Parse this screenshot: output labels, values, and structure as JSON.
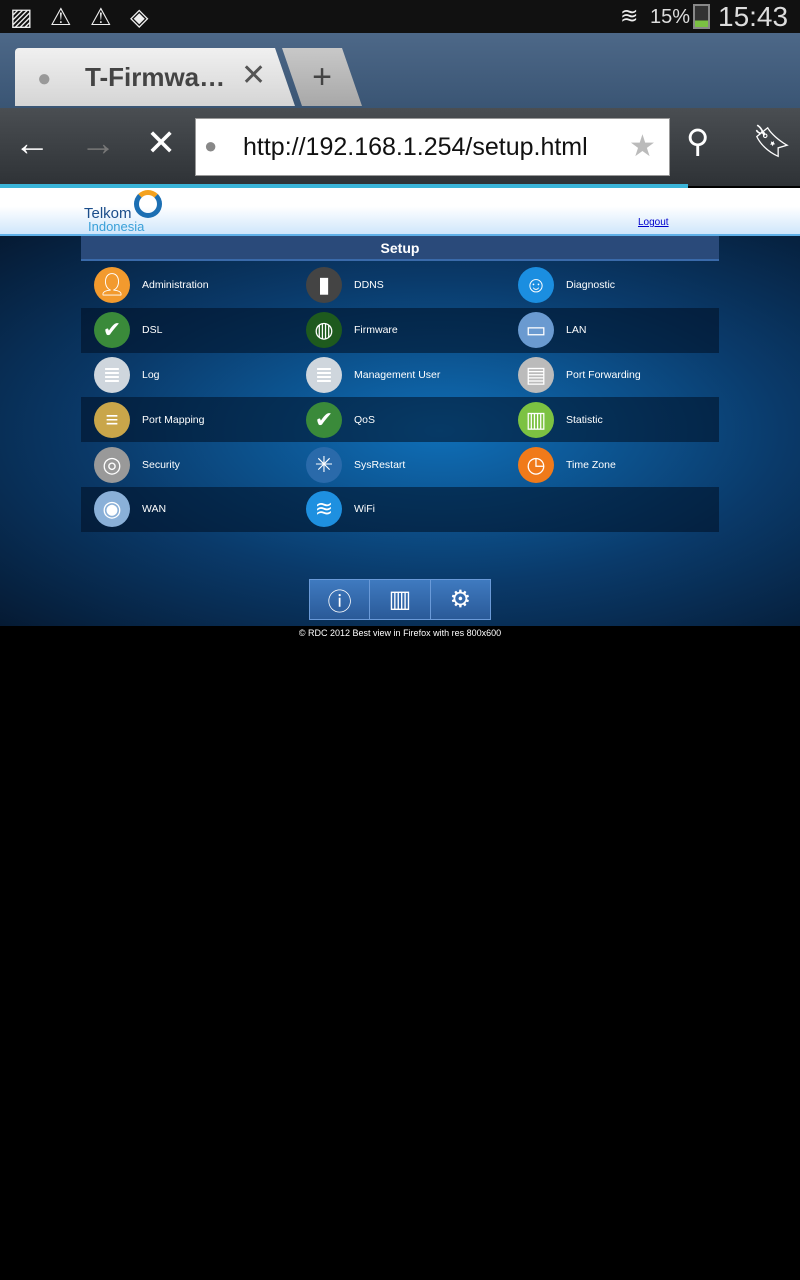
{
  "status_bar": {
    "icons": [
      "gallery-icon",
      "warning-icon",
      "warning-icon",
      "dropbox-icon"
    ],
    "battery": "15%",
    "battery_level": 15,
    "time": "15:43"
  },
  "browser": {
    "tab_title": "T-Firmwa…",
    "url": "http://192.168.1.254/setup.html",
    "load_progress": 86
  },
  "header": {
    "logo_line1": "Telkom",
    "logo_line2": "Indonesia",
    "logout": "Logout"
  },
  "setup": {
    "title": "Setup",
    "items": [
      {
        "label": "Administration",
        "icon": "user-icon",
        "color": "#f29a2e"
      },
      {
        "label": "DDNS",
        "icon": "server-icon",
        "color": "#444"
      },
      {
        "label": "Diagnostic",
        "icon": "doctor-icon",
        "color": "#1b8ee0"
      },
      {
        "label": "DSL",
        "icon": "globe-checklist-icon",
        "color": "#3a8a3a"
      },
      {
        "label": "Firmware",
        "icon": "matrix-globe-icon",
        "color": "#1e5a1e"
      },
      {
        "label": "LAN",
        "icon": "computers-icon",
        "color": "#6a9ad0"
      },
      {
        "label": "Log",
        "icon": "scroll-icon",
        "color": "#cfd6dd"
      },
      {
        "label": "Management User",
        "icon": "scroll-icon",
        "color": "#cfd6dd"
      },
      {
        "label": "Port Forwarding",
        "icon": "ethernet-plug-icon",
        "color": "#bbbbbb"
      },
      {
        "label": "Port Mapping",
        "icon": "cables-icon",
        "color": "#c9a64a"
      },
      {
        "label": "QoS",
        "icon": "globe-checklist-icon",
        "color": "#3a8a3a"
      },
      {
        "label": "Statistic",
        "icon": "bar-chart-icon",
        "color": "#7cc242"
      },
      {
        "label": "Security",
        "icon": "safe-dial-icon",
        "color": "#999"
      },
      {
        "label": "SysRestart",
        "icon": "restart-burst-icon",
        "color": "#2a6aaa"
      },
      {
        "label": "Time Zone",
        "icon": "clock-icon",
        "color": "#f07a1a"
      },
      {
        "label": "WAN",
        "icon": "network-globe-icon",
        "color": "#8ab0d8"
      },
      {
        "label": "WiFi",
        "icon": "wifi-icon",
        "color": "#1e90e0"
      }
    ]
  },
  "bottom_nav": [
    "info-icon",
    "status-chart-icon",
    "settings-gear-icon"
  ],
  "footer": "© RDC 2012 Best view in Firefox with res 800x600"
}
